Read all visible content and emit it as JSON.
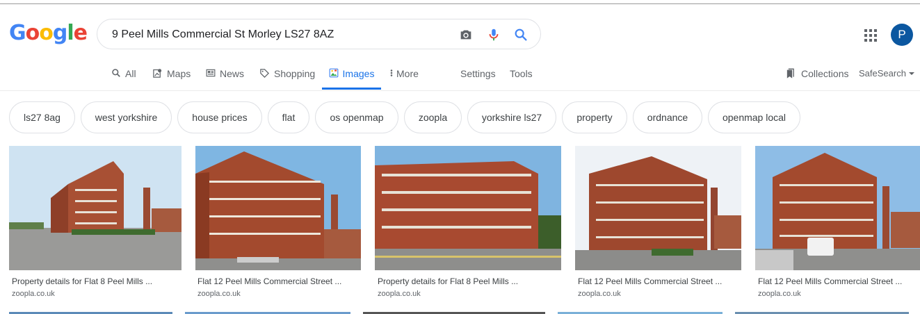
{
  "search": {
    "query": "9 Peel Mills Commercial St Morley LS27 8AZ"
  },
  "logo": {
    "letters": [
      "G",
      "o",
      "o",
      "g",
      "l",
      "e"
    ],
    "colors": [
      "#4285F4",
      "#EA4335",
      "#FBBC05",
      "#4285F4",
      "#34A853",
      "#EA4335"
    ]
  },
  "search_icons": [
    "camera-icon",
    "microphone-icon",
    "search-icon"
  ],
  "account": {
    "avatar_letter": "P"
  },
  "tabs": [
    {
      "label": "All",
      "icon": "search-icon"
    },
    {
      "label": "Maps",
      "icon": "map-icon"
    },
    {
      "label": "News",
      "icon": "news-icon"
    },
    {
      "label": "Shopping",
      "icon": "tag-icon"
    },
    {
      "label": "Images",
      "icon": "image-icon",
      "active": true
    },
    {
      "label": "More",
      "icon": "more-vertical-icon"
    }
  ],
  "tools": {
    "settings": "Settings",
    "tools": "Tools",
    "collections": "Collections",
    "safesearch": "SafeSearch"
  },
  "chips": [
    "ls27 8ag",
    "west yorkshire",
    "house prices",
    "flat",
    "os openmap",
    "zoopla",
    "yorkshire ls27",
    "property",
    "ordnance",
    "openmap local"
  ],
  "results": [
    {
      "title": "Property details for Flat 8 Peel Mills ...",
      "source": "zoopla.co.uk"
    },
    {
      "title": "Flat 12 Peel Mills Commercial Street ...",
      "source": "zoopla.co.uk"
    },
    {
      "title": "Property details for Flat 8 Peel Mills ...",
      "source": "zoopla.co.uk"
    },
    {
      "title": "Flat 12 Peel Mills Commercial Street ...",
      "source": "zoopla.co.uk"
    },
    {
      "title": "Flat 12 Peel Mills Commercial Street ...",
      "source": "zoopla.co.uk"
    }
  ],
  "colors": {
    "accent": "#1a73e8",
    "avatar": "#0b57a0",
    "brick": "#a34a2e",
    "sky": "#9cc6e8"
  }
}
